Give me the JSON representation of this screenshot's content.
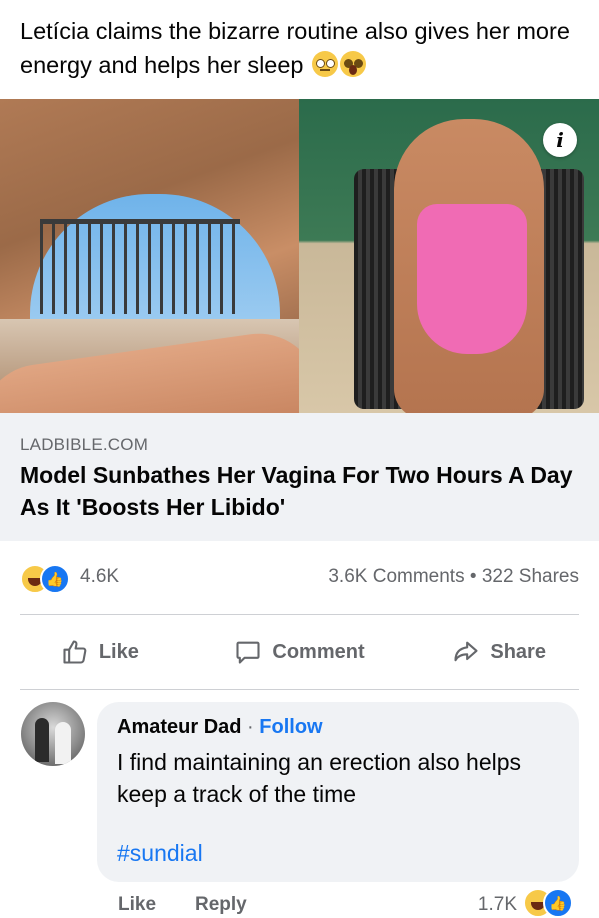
{
  "post": {
    "caption": "Letícia claims the bizarre routine also gives her more energy and helps her sleep",
    "caption_emojis": [
      "flushed-face-emoji",
      "astonished-face-emoji"
    ]
  },
  "link": {
    "domain": "LADBIBLE.COM",
    "headline": "Model Sunbathes Her Vagina For Two Hours A Day As It 'Boosts Her Libido'",
    "info_glyph": "i"
  },
  "stats": {
    "reactions_count": "4.6K",
    "comments": "3.6K Comments",
    "separator": "•",
    "shares": "322 Shares",
    "reaction_icons": [
      "haha-reaction-icon",
      "like-reaction-icon"
    ]
  },
  "actions": {
    "like": "Like",
    "comment": "Comment",
    "share": "Share"
  },
  "comment": {
    "author": "Amateur Dad",
    "separator": "·",
    "follow": "Follow",
    "text": "I find maintaining an erection also helps keep a track of the time",
    "hashtag": "#sundial",
    "like": "Like",
    "reply": "Reply",
    "reactions_count": "1.7K"
  },
  "colors": {
    "link_blue": "#1877f2",
    "secondary_text": "#65676b",
    "bubble_bg": "#f0f2f5"
  }
}
